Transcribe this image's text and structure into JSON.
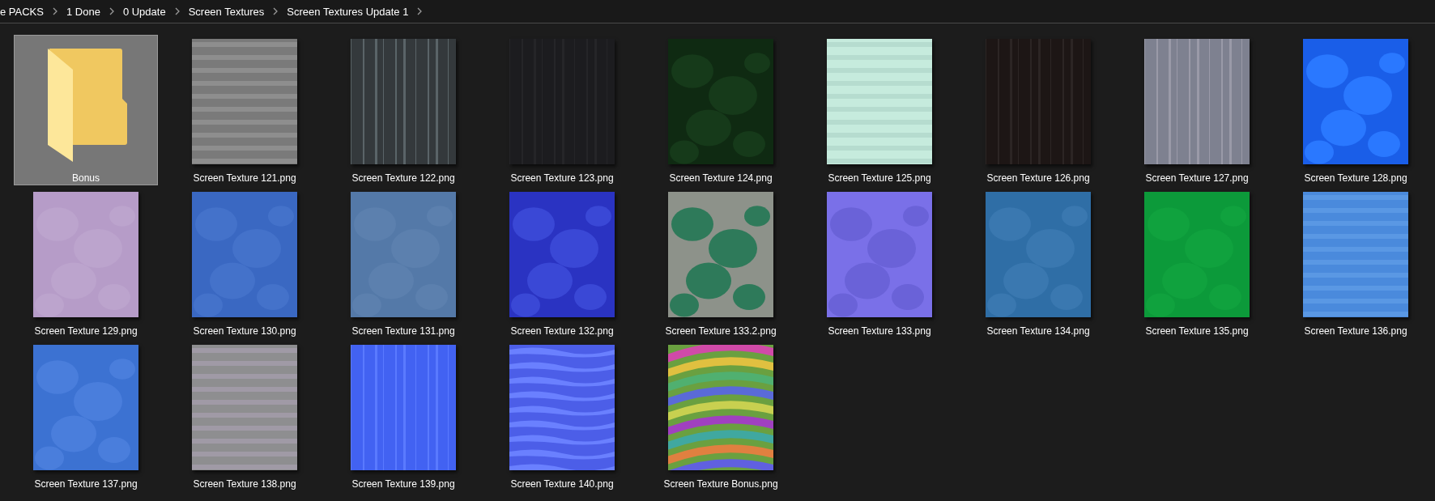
{
  "breadcrumb": [
    {
      "label": "e PACKS"
    },
    {
      "label": "1 Done"
    },
    {
      "label": "0 Update"
    },
    {
      "label": "Screen Textures"
    },
    {
      "label": "Screen Textures Update 1"
    }
  ],
  "items": [
    {
      "name": "Bonus",
      "kind": "folder",
      "selected": true
    },
    {
      "name": "Screen Texture 121.png",
      "kind": "picture",
      "selected": false
    },
    {
      "name": "Screen Texture 122.png",
      "kind": "picture",
      "selected": false
    },
    {
      "name": "Screen Texture 123.png",
      "kind": "picture",
      "selected": false
    },
    {
      "name": "Screen Texture 124.png",
      "kind": "picture",
      "selected": false
    },
    {
      "name": "Screen Texture 125.png",
      "kind": "picture",
      "selected": false
    },
    {
      "name": "Screen Texture 126.png",
      "kind": "picture",
      "selected": false
    },
    {
      "name": "Screen Texture 127.png",
      "kind": "picture",
      "selected": false
    },
    {
      "name": "Screen Texture 128.png",
      "kind": "picture",
      "selected": false
    },
    {
      "name": "Screen Texture 129.png",
      "kind": "picture",
      "selected": false
    },
    {
      "name": "Screen Texture 130.png",
      "kind": "picture",
      "selected": false
    },
    {
      "name": "Screen Texture 131.png",
      "kind": "picture",
      "selected": false
    },
    {
      "name": "Screen Texture 132.png",
      "kind": "picture",
      "selected": false
    },
    {
      "name": "Screen Texture 133.2.png",
      "kind": "picture",
      "selected": false
    },
    {
      "name": "Screen Texture 133.png",
      "kind": "picture",
      "selected": false
    },
    {
      "name": "Screen Texture 134.png",
      "kind": "picture",
      "selected": false
    },
    {
      "name": "Screen Texture 135.png",
      "kind": "picture",
      "selected": false
    },
    {
      "name": "Screen Texture 136.png",
      "kind": "picture",
      "selected": false
    },
    {
      "name": "Screen Texture 137.png",
      "kind": "picture",
      "selected": false
    },
    {
      "name": "Screen Texture 138.png",
      "kind": "picture",
      "selected": false
    },
    {
      "name": "Screen Texture 139.png",
      "kind": "picture",
      "selected": false
    },
    {
      "name": "Screen Texture 140.png",
      "kind": "picture",
      "selected": false
    },
    {
      "name": "Screen Texture Bonus.png",
      "kind": "picture",
      "selected": false
    }
  ]
}
